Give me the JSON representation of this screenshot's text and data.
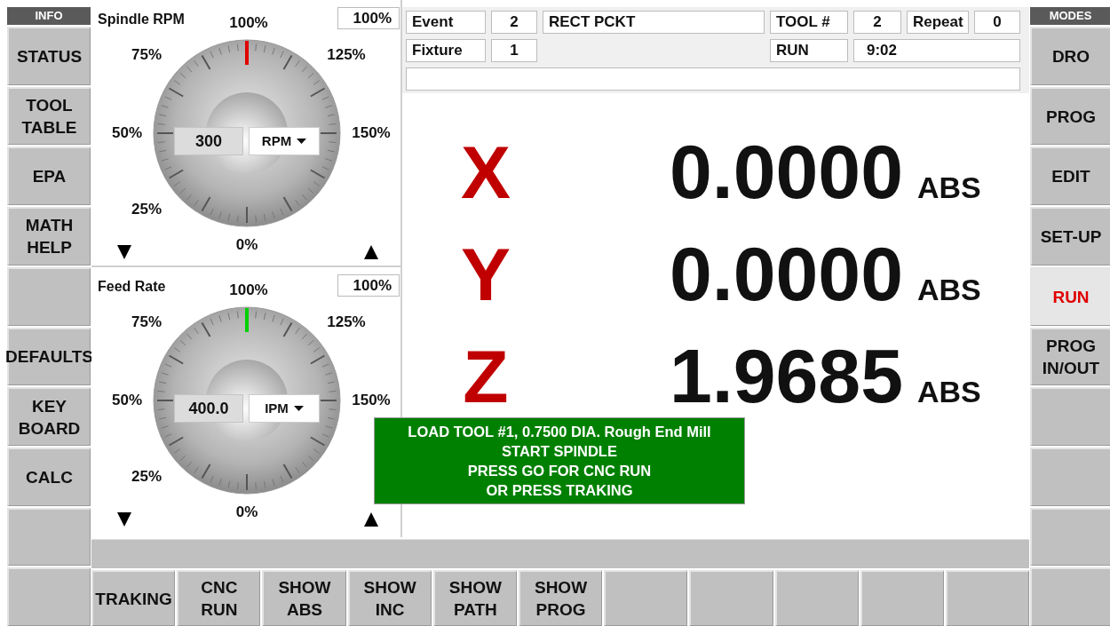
{
  "info_header": "INFO",
  "info_buttons": [
    {
      "kind": "label",
      "lines": [
        "STATUS"
      ]
    },
    {
      "kind": "label",
      "lines": [
        "TOOL",
        "TABLE"
      ]
    },
    {
      "kind": "label",
      "lines": [
        "EPA"
      ]
    },
    {
      "kind": "label",
      "lines": [
        "MATH",
        "HELP"
      ]
    },
    {
      "kind": "blank"
    },
    {
      "kind": "label",
      "lines": [
        "DEFAULTS"
      ]
    },
    {
      "kind": "label",
      "lines": [
        "KEY",
        "BOARD"
      ]
    },
    {
      "kind": "label",
      "lines": [
        "CALC"
      ]
    },
    {
      "kind": "blank"
    },
    {
      "kind": "blank"
    }
  ],
  "dials": [
    {
      "title": "Spindle RPM",
      "percent": "100%",
      "scale_labels": [
        "0%",
        "25%",
        "50%",
        "75%",
        "100%",
        "125%",
        "150%"
      ],
      "value": "300",
      "unit": "RPM",
      "color": "#e00000"
    },
    {
      "title": "Feed Rate",
      "percent": "100%",
      "scale_labels": [
        "0%",
        "25%",
        "50%",
        "75%",
        "100%",
        "125%",
        "150%"
      ],
      "value": "400.0",
      "unit": "IPM",
      "color": "#00d000"
    }
  ],
  "job_info": {
    "event_label": "Event",
    "event": "2",
    "program": "RECT PCKT",
    "tool_label": "TOOL #",
    "tool": "2",
    "repeat_label": "Repeat",
    "repeat": "0",
    "fixture_label": "Fixture",
    "fixture": "1",
    "status": "RUN",
    "time": "9:02"
  },
  "dro": [
    {
      "axis": "X",
      "value": "0.0000",
      "mode": "ABS"
    },
    {
      "axis": "Y",
      "value": "0.0000",
      "mode": "ABS"
    },
    {
      "axis": "Z",
      "value": "1.9685",
      "mode": "ABS"
    }
  ],
  "message": {
    "lines": [
      "LOAD TOOL #1, 0.7500 DIA. Rough End Mill",
      "START SPINDLE",
      "PRESS GO FOR CNC RUN",
      "OR PRESS TRAKING"
    ]
  },
  "modes_header": "MODES",
  "mode_buttons": [
    {
      "kind": "label",
      "lines": [
        "DRO"
      ],
      "selected": false
    },
    {
      "kind": "label",
      "lines": [
        "PROG"
      ],
      "selected": false
    },
    {
      "kind": "label",
      "lines": [
        "EDIT"
      ],
      "selected": false
    },
    {
      "kind": "label",
      "lines": [
        "SET-UP"
      ],
      "selected": false
    },
    {
      "kind": "label",
      "lines": [
        "RUN"
      ],
      "selected": true
    },
    {
      "kind": "label",
      "lines": [
        "PROG",
        "IN/OUT"
      ],
      "selected": false
    },
    {
      "kind": "blank",
      "selected": false
    },
    {
      "kind": "blank",
      "selected": false
    },
    {
      "kind": "blank",
      "selected": false
    },
    {
      "kind": "blank",
      "selected": false
    }
  ],
  "function_buttons": [
    {
      "kind": "label",
      "lines": [
        "TRAKING"
      ]
    },
    {
      "kind": "label",
      "lines": [
        "CNC",
        "RUN"
      ]
    },
    {
      "kind": "label",
      "lines": [
        "SHOW",
        "ABS"
      ]
    },
    {
      "kind": "label",
      "lines": [
        "SHOW",
        "INC"
      ]
    },
    {
      "kind": "label",
      "lines": [
        "SHOW",
        "PATH"
      ]
    },
    {
      "kind": "label",
      "lines": [
        "SHOW",
        "PROG"
      ]
    },
    {
      "kind": "blank"
    },
    {
      "kind": "blank"
    },
    {
      "kind": "blank"
    },
    {
      "kind": "blank"
    },
    {
      "kind": "blank"
    }
  ]
}
